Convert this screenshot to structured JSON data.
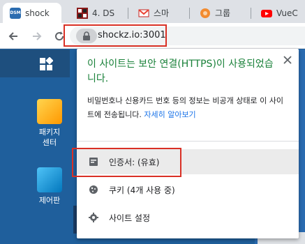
{
  "tabs": [
    {
      "title": "shock",
      "favicon": "dsm-favicon",
      "favicon_text": "DSM",
      "active": true
    },
    {
      "title": "4. DS",
      "favicon": "grid-favicon",
      "active": false
    },
    {
      "title": "스마",
      "favicon": "gmail-favicon",
      "active": false
    },
    {
      "title": "그룹",
      "favicon": "orange-circle-favicon",
      "active": false
    },
    {
      "title": "VueC",
      "favicon": "youtube-favicon",
      "active": false
    }
  ],
  "toolbar": {
    "url": "shockz.io:3001"
  },
  "background": {
    "icons": [
      {
        "label_line1": "패키지",
        "label_line2": "센터"
      },
      {
        "label_line1": "제어판",
        "label_line2": ""
      }
    ]
  },
  "popup": {
    "title": "이 사이트는 보안 연결(HTTPS)이 사용되었습니다.",
    "description": "비밀번호나 신용카드 번호 등의 정보는 비공개 상태로 이 사이트에 전송됩니다.",
    "learn_more": "자세히 알아보기",
    "menu": [
      {
        "label": "인증서: (유효)",
        "icon": "certificate-icon"
      },
      {
        "label": "쿠키 (4개 사용 중)",
        "icon": "cookie-icon"
      },
      {
        "label": "사이트 설정",
        "icon": "settings-gear-icon"
      }
    ]
  },
  "colors": {
    "secure_green": "#188038",
    "link_blue": "#1a73e8",
    "highlight_red": "#d93025"
  }
}
